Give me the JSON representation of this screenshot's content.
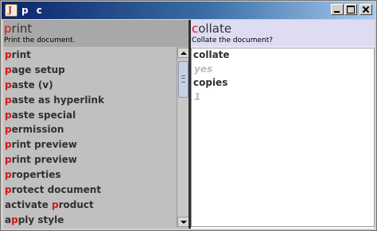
{
  "window": {
    "title": "p c",
    "app_icon_glyph": "J",
    "buttons": {
      "minimize": "minimize",
      "maximize": "maximize",
      "close": "close"
    }
  },
  "left_panel": {
    "command": {
      "first": "p",
      "rest": "rint"
    },
    "description": "Print the document.",
    "items": [
      {
        "pre": "",
        "hl": "p",
        "post": "rint"
      },
      {
        "pre": "",
        "hl": "p",
        "post": "age setup"
      },
      {
        "pre": "",
        "hl": "p",
        "post": "aste (v)"
      },
      {
        "pre": "",
        "hl": "p",
        "post": "aste as hyperlink"
      },
      {
        "pre": "",
        "hl": "p",
        "post": "aste special"
      },
      {
        "pre": "",
        "hl": "p",
        "post": "ermission"
      },
      {
        "pre": "",
        "hl": "p",
        "post": "rint preview"
      },
      {
        "pre": "",
        "hl": "p",
        "post": "rint preview"
      },
      {
        "pre": "",
        "hl": "p",
        "post": "roperties"
      },
      {
        "pre": "",
        "hl": "p",
        "post": "rotect document"
      },
      {
        "pre": "activate ",
        "hl": "p",
        "post": "roduct"
      },
      {
        "pre": "a",
        "hl": "p",
        "post": "ply style"
      }
    ]
  },
  "right_panel": {
    "option": {
      "first": "c",
      "rest": "ollate"
    },
    "description": "Collate the document?",
    "params": [
      {
        "name": "collate",
        "value": "yes"
      },
      {
        "name": "copies",
        "value": "1"
      }
    ]
  },
  "colors": {
    "highlight": "#d01818",
    "left_header_bg": "#a8a8a8",
    "right_header_bg": "#dedcf2",
    "list_bg": "#c0c0c0",
    "param_value": "#bcbcbc"
  }
}
